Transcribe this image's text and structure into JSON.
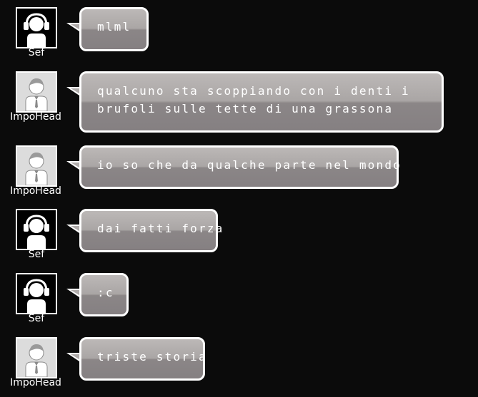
{
  "messages": [
    {
      "user": "Sef",
      "avatar": "headphones-avatar-icon",
      "text": "mlml",
      "lines": [
        "mlml"
      ]
    },
    {
      "user": "ImpoHead",
      "avatar": "person-avatar-icon",
      "text": "qualcuno sta scoppiando con i denti i brufoli sulle tette di una grassona",
      "lines": [
        "qualcuno sta scoppiando con i denti i",
        "brufoli sulle tette di una grassona"
      ]
    },
    {
      "user": "ImpoHead",
      "avatar": "person-avatar-icon",
      "text": "io so che da qualche parte nel mondo",
      "lines": [
        "io so che da qualche parte nel mondo"
      ]
    },
    {
      "user": "Sef",
      "avatar": "headphones-avatar-icon",
      "text": "dai fatti forza",
      "lines": [
        "dai fatti forza"
      ]
    },
    {
      "user": "Sef",
      "avatar": "headphones-avatar-icon",
      "text": ":c",
      "lines": [
        ":c"
      ]
    },
    {
      "user": "ImpoHead",
      "avatar": "person-avatar-icon",
      "text": "triste storia",
      "lines": [
        "triste storia"
      ]
    }
  ],
  "colors": {
    "background": "#0b0b0b",
    "bubble_top": "#bcb8b7",
    "bubble_bottom": "#858082",
    "border": "#ffffff"
  }
}
